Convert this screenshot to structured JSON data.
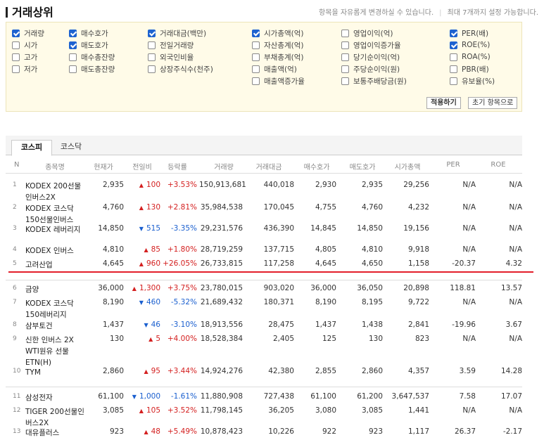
{
  "header": {
    "title": "거래상위",
    "hint1": "항목을 자유롭게 변경하실 수 있습니다.",
    "hint2": "최대 7개까지 설정 가능합니다."
  },
  "options": [
    {
      "label": "거래량",
      "checked": true
    },
    {
      "label": "시가",
      "checked": false
    },
    {
      "label": "고가",
      "checked": false
    },
    {
      "label": "저가",
      "checked": false
    },
    {
      "label": "매수호가",
      "checked": true
    },
    {
      "label": "매도호가",
      "checked": true
    },
    {
      "label": "매수총잔량",
      "checked": false
    },
    {
      "label": "매도총잔량",
      "checked": false
    },
    {
      "label": "거래대금(백만)",
      "checked": true
    },
    {
      "label": "전일거래량",
      "checked": false
    },
    {
      "label": "외국인비율",
      "checked": false
    },
    {
      "label": "상장주식수(천주)",
      "checked": false
    },
    {
      "label": "시가총액(억)",
      "checked": true
    },
    {
      "label": "자산총계(억)",
      "checked": false
    },
    {
      "label": "부채총계(억)",
      "checked": false
    },
    {
      "label": "매출액(억)",
      "checked": false
    },
    {
      "label": "매출액증가율",
      "checked": false
    },
    {
      "label": "영업이익(억)",
      "checked": false
    },
    {
      "label": "영업이익증가율",
      "checked": false
    },
    {
      "label": "당기순이익(억)",
      "checked": false
    },
    {
      "label": "주당순이익(원)",
      "checked": false
    },
    {
      "label": "보통주배당금(원)",
      "checked": false
    },
    {
      "label": "PER(배)",
      "checked": true
    },
    {
      "label": "ROE(%)",
      "checked": true
    },
    {
      "label": "ROA(%)",
      "checked": false
    },
    {
      "label": "PBR(배)",
      "checked": false
    },
    {
      "label": "유보율(%)",
      "checked": false
    }
  ],
  "buttons": {
    "apply": "적용하기",
    "reset": "초기 항목으로"
  },
  "tabs": [
    "코스피",
    "코스닥"
  ],
  "columns": [
    "N",
    "종목명",
    "현재가",
    "전일비",
    "등락률",
    "거래량",
    "거래대금",
    "매수호가",
    "매도호가",
    "시가총액",
    "PER",
    "ROE"
  ],
  "rows": [
    {
      "n": "1",
      "name": "KODEX 200선물인버스2X",
      "price": "2,935",
      "dir": "up",
      "diff": "100",
      "rate": "+3.53%",
      "vol": "150,913,681",
      "amt": "440,018",
      "bid": "2,930",
      "ask": "2,935",
      "cap": "29,256",
      "per": "N/A",
      "roe": "N/A"
    },
    {
      "n": "2",
      "name": "KODEX 코스닥150선물인버스",
      "price": "4,760",
      "dir": "up",
      "diff": "130",
      "rate": "+2.81%",
      "vol": "35,984,538",
      "amt": "170,045",
      "bid": "4,755",
      "ask": "4,760",
      "cap": "4,232",
      "per": "N/A",
      "roe": "N/A"
    },
    {
      "n": "3",
      "name": "KODEX 레버리지",
      "price": "14,850",
      "dir": "down",
      "diff": "515",
      "rate": "-3.35%",
      "vol": "29,231,576",
      "amt": "436,390",
      "bid": "14,845",
      "ask": "14,850",
      "cap": "19,156",
      "per": "N/A",
      "roe": "N/A"
    },
    {
      "n": "4",
      "name": "KODEX 인버스",
      "price": "4,810",
      "dir": "up",
      "diff": "85",
      "rate": "+1.80%",
      "vol": "28,719,259",
      "amt": "137,715",
      "bid": "4,805",
      "ask": "4,810",
      "cap": "9,918",
      "per": "N/A",
      "roe": "N/A"
    },
    {
      "n": "5",
      "name": "고려산업",
      "price": "4,645",
      "dir": "up",
      "diff": "960",
      "rate": "+26.05%",
      "vol": "26,733,815",
      "amt": "117,258",
      "bid": "4,645",
      "ask": "4,650",
      "cap": "1,158",
      "per": "-20.37",
      "roe": "4.32"
    },
    {
      "n": "6",
      "name": "금양",
      "price": "36,000",
      "dir": "up",
      "diff": "1,300",
      "rate": "+3.75%",
      "vol": "23,780,015",
      "amt": "903,020",
      "bid": "36,000",
      "ask": "36,050",
      "cap": "20,898",
      "per": "118.81",
      "roe": "13.57"
    },
    {
      "n": "7",
      "name": "KODEX 코스닥150레버리지",
      "price": "8,190",
      "dir": "down",
      "diff": "460",
      "rate": "-5.32%",
      "vol": "21,689,432",
      "amt": "180,371",
      "bid": "8,190",
      "ask": "8,195",
      "cap": "9,722",
      "per": "N/A",
      "roe": "N/A"
    },
    {
      "n": "8",
      "name": "삼부토건",
      "price": "1,437",
      "dir": "down",
      "diff": "46",
      "rate": "-3.10%",
      "vol": "18,913,556",
      "amt": "28,475",
      "bid": "1,437",
      "ask": "1,438",
      "cap": "2,841",
      "per": "-19.96",
      "roe": "3.67"
    },
    {
      "n": "9",
      "name": "신한 인버스 2X WTI원유 선물 ETN(H)",
      "price": "130",
      "dir": "up",
      "diff": "5",
      "rate": "+4.00%",
      "vol": "18,528,384",
      "amt": "2,405",
      "bid": "125",
      "ask": "130",
      "cap": "823",
      "per": "N/A",
      "roe": "N/A"
    },
    {
      "n": "10",
      "name": "TYM",
      "price": "2,860",
      "dir": "up",
      "diff": "95",
      "rate": "+3.44%",
      "vol": "14,924,276",
      "amt": "42,380",
      "bid": "2,855",
      "ask": "2,860",
      "cap": "4,357",
      "per": "3.59",
      "roe": "14.28"
    },
    {
      "n": "11",
      "name": "삼성전자",
      "price": "61,100",
      "dir": "down",
      "diff": "1,000",
      "rate": "-1.61%",
      "vol": "11,880,908",
      "amt": "727,438",
      "bid": "61,100",
      "ask": "61,200",
      "cap": "3,647,537",
      "per": "7.58",
      "roe": "17.07"
    },
    {
      "n": "12",
      "name": "TIGER 200선물인버스2X",
      "price": "3,085",
      "dir": "up",
      "diff": "105",
      "rate": "+3.52%",
      "vol": "11,798,145",
      "amt": "36,205",
      "bid": "3,080",
      "ask": "3,085",
      "cap": "1,441",
      "per": "N/A",
      "roe": "N/A"
    },
    {
      "n": "13",
      "name": "대유플러스",
      "price": "923",
      "dir": "up",
      "diff": "48",
      "rate": "+5.49%",
      "vol": "10,878,423",
      "amt": "10,226",
      "bid": "922",
      "ask": "923",
      "cap": "1,117",
      "per": "26.37",
      "roe": "-2.17"
    }
  ],
  "colors": {
    "up": "#d42020",
    "down": "#1a5fcf",
    "highlight_line": "#e31e2a",
    "option_bg": "#fffbe8"
  }
}
